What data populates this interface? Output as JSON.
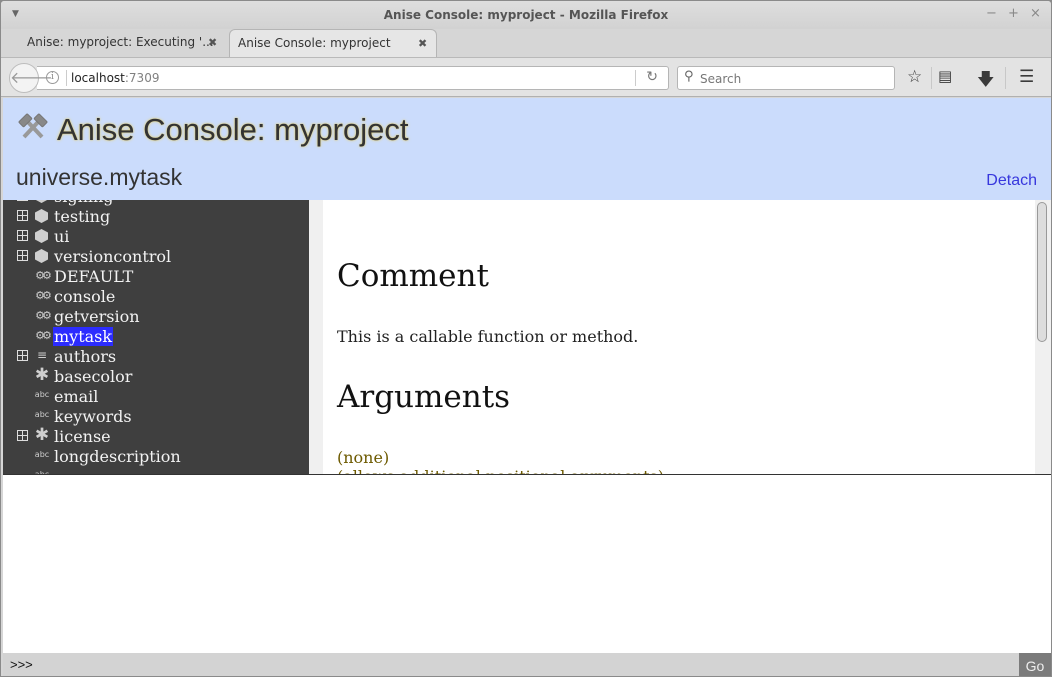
{
  "window": {
    "title": "Anise Console: myproject - Mozilla Firefox",
    "controls": {
      "minimize": "−",
      "maximize": "+",
      "close": "×"
    }
  },
  "tabs": [
    {
      "label": "Anise: myproject: Executing '...",
      "active": false
    },
    {
      "label": "Anise Console: myproject",
      "active": true
    }
  ],
  "navbar": {
    "url_host": "localhost",
    "url_port": ":7309",
    "search_placeholder": "Search"
  },
  "header": {
    "app_title": "Anise Console: myproject",
    "path": "universe.mytask",
    "detach_label": "Detach",
    "colors": {
      "background": "#cbdcfc",
      "link": "#3737dd"
    }
  },
  "tree": {
    "selected_color": "#2c2cff",
    "items": [
      {
        "label": "signing",
        "icon": "cube",
        "expandable": true
      },
      {
        "label": "testing",
        "icon": "cube",
        "expandable": true
      },
      {
        "label": "ui",
        "icon": "cube",
        "expandable": true
      },
      {
        "label": "versioncontrol",
        "icon": "cube",
        "expandable": true
      },
      {
        "label": "DEFAULT",
        "icon": "gears",
        "expandable": false
      },
      {
        "label": "console",
        "icon": "gears",
        "expandable": false
      },
      {
        "label": "getversion",
        "icon": "gears",
        "expandable": false
      },
      {
        "label": "mytask",
        "icon": "gears",
        "expandable": false,
        "selected": true
      },
      {
        "label": "authors",
        "icon": "list",
        "expandable": true
      },
      {
        "label": "basecolor",
        "icon": "star",
        "expandable": false
      },
      {
        "label": "email",
        "icon": "abc",
        "expandable": false
      },
      {
        "label": "keywords",
        "icon": "abc",
        "expandable": false
      },
      {
        "label": "license",
        "icon": "star",
        "expandable": true
      },
      {
        "label": "longdescription",
        "icon": "abc",
        "expandable": false
      },
      {
        "label": "",
        "icon": "abc",
        "expandable": false
      }
    ]
  },
  "content": {
    "comment_heading": "Comment",
    "comment_text": "This is a callable function or method.",
    "arguments_heading": "Arguments",
    "arguments_none": "(none)",
    "arguments_extra": "(allows additional positional arguments)",
    "argument_color": "#6d5a00"
  },
  "console": {
    "prompt": ">>>",
    "input_value": "",
    "go_label": "Go"
  }
}
